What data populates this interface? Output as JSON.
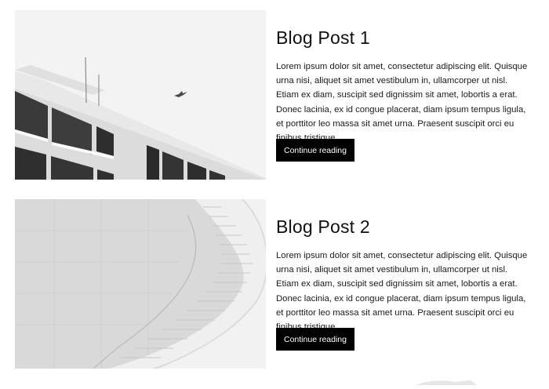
{
  "posts": [
    {
      "title": "Blog Post 1",
      "excerpt": "Lorem ipsum dolor sit amet, consectetur adipiscing elit. Quisque urna nisi, aliquet sit amet vestibulum in, ullamcorper ut nisl. Etiam ex diam, suscipit sed dignissim sit amet, lobortis a erat. Donec lacinia, ex id congue placerat, diam ipsum tempus ligula, et porttitor leo massa sit amet urna. Praesent suscipit orci eu finibus tristique.",
      "button_label": "Continue reading",
      "image": "white-building-with-bird"
    },
    {
      "title": "Blog Post 2",
      "excerpt": "Lorem ipsum dolor sit amet, consectetur adipiscing elit. Quisque urna nisi, aliquet sit amet vestibulum in, ullamcorper ut nisl. Etiam ex diam, suscipit sed dignissim sit amet, lobortis a erat. Donec lacinia, ex id congue placerat, diam ipsum tempus ligula, et porttitor leo massa sit amet urna. Praesent suscipit orci eu finibus tristique.",
      "button_label": "Continue reading",
      "image": "curved-white-staircase"
    }
  ]
}
